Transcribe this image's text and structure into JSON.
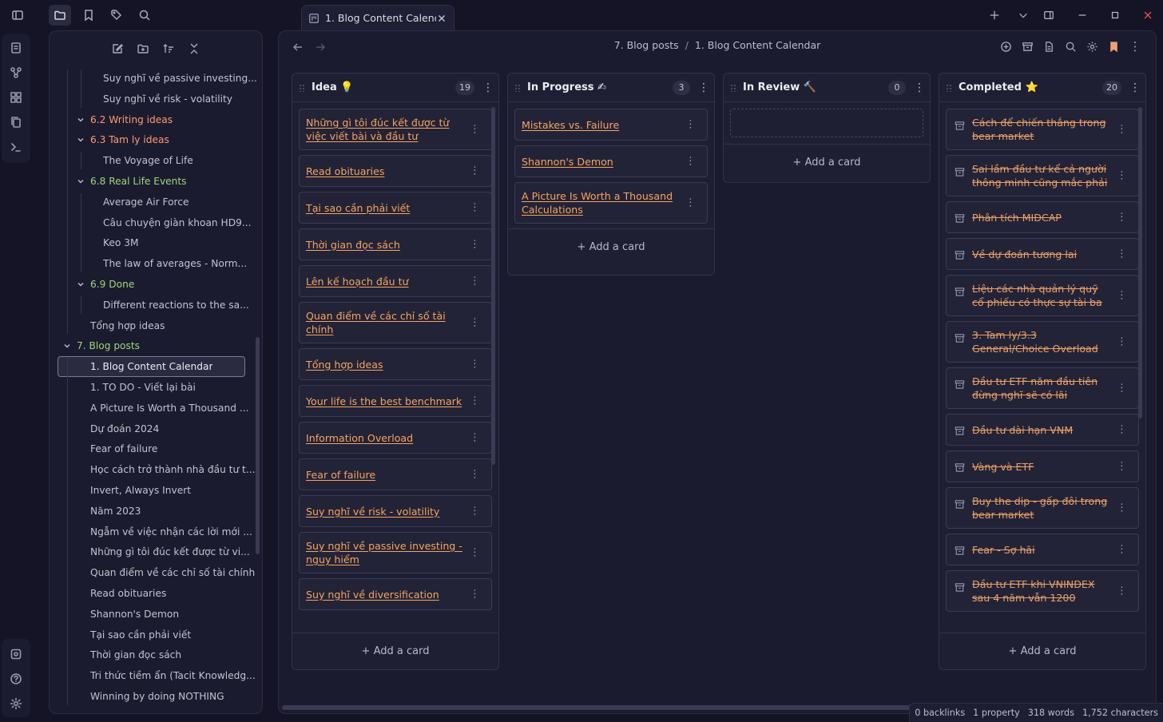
{
  "tab": {
    "title": "1. Blog Content Calend..."
  },
  "breadcrumb": {
    "parent": "7. Blog posts",
    "separator": "/",
    "current": "1. Blog Content Calendar"
  },
  "sidebar": {
    "items": [
      {
        "label": "Suy nghĩ về passive investing...",
        "kind": "file",
        "indent": 2
      },
      {
        "label": "Suy nghĩ về risk - volatility",
        "kind": "file",
        "indent": 2
      },
      {
        "label": "6.2 Writing ideas",
        "kind": "folder",
        "indent": 1
      },
      {
        "label": "6.3 Tam ly ideas",
        "kind": "folder",
        "indent": 1
      },
      {
        "label": "The Voyage of Life",
        "kind": "file",
        "indent": 2
      },
      {
        "label": "6.8 Real Life Events",
        "kind": "folder-green",
        "indent": 1
      },
      {
        "label": "Average Air Force",
        "kind": "file",
        "indent": 2
      },
      {
        "label": "Câu chuyện giàn khoan HD9...",
        "kind": "file",
        "indent": 2
      },
      {
        "label": "Keo 3M",
        "kind": "file",
        "indent": 2
      },
      {
        "label": "The law of averages - Norm...",
        "kind": "file",
        "indent": 2
      },
      {
        "label": "6.9 Done",
        "kind": "folder-green",
        "indent": 1
      },
      {
        "label": "Different reactions to the sa...",
        "kind": "file",
        "indent": 2
      },
      {
        "label": "Tổng hợp ideas",
        "kind": "file",
        "indent": 1
      },
      {
        "label": "7. Blog posts",
        "kind": "folder-green",
        "indent": 0
      },
      {
        "label": "1. Blog Content Calendar",
        "kind": "selected",
        "indent": 1
      },
      {
        "label": "1. TO DO - Viết lại bài",
        "kind": "file",
        "indent": 1
      },
      {
        "label": "A Picture Is Worth a Thousand ...",
        "kind": "file",
        "indent": 1
      },
      {
        "label": "Dự đoán 2024",
        "kind": "file",
        "indent": 1
      },
      {
        "label": "Fear of failure",
        "kind": "file",
        "indent": 1
      },
      {
        "label": "Học cách trở thành nhà đầu tư t...",
        "kind": "file",
        "indent": 1
      },
      {
        "label": "Invert, Always Invert",
        "kind": "file",
        "indent": 1
      },
      {
        "label": "Năm 2023",
        "kind": "file",
        "indent": 1
      },
      {
        "label": "Ngẫm về việc nhận các lời mới ...",
        "kind": "file",
        "indent": 1
      },
      {
        "label": "Những gì tôi đúc kết được từ vi...",
        "kind": "file",
        "indent": 1
      },
      {
        "label": "Quan điểm về các chỉ số tài chính",
        "kind": "file",
        "indent": 1
      },
      {
        "label": "Read obituaries",
        "kind": "file",
        "indent": 1
      },
      {
        "label": "Shannon's Demon",
        "kind": "file",
        "indent": 1
      },
      {
        "label": "Tại sao cần phải viết",
        "kind": "file",
        "indent": 1
      },
      {
        "label": "Thời gian đọc sách",
        "kind": "file",
        "indent": 1
      },
      {
        "label": "Tri thức tiềm ẩn (Tacit Knowledg...",
        "kind": "file",
        "indent": 1
      },
      {
        "label": "Winning by doing NOTHING",
        "kind": "file",
        "indent": 1
      }
    ]
  },
  "board": {
    "add_card_label": "+ Add a card",
    "lanes": [
      {
        "title": "Idea 💡",
        "count": "19",
        "cards": [
          "Những gì tôi đúc kết được từ việc viết bài và đầu tư",
          "Read obituaries",
          "Tại sao cần phải viết",
          "Thời gian đọc sách",
          "Lên kế hoạch đầu tư",
          "Quan điểm về các chỉ số tài chính",
          "Tổng hợp ideas",
          "Your life is the best benchmark",
          "Information Overload",
          "Fear of failure",
          "Suy nghĩ về risk - volatility",
          "Suy nghĩ về passive investing - nguy hiểm",
          "Suy nghĩ về diversification"
        ]
      },
      {
        "title": "In Progress ✍",
        "count": "3",
        "cards": [
          "Mistakes vs. Failure",
          "Shannon's Demon",
          "A Picture Is Worth a Thousand Calculations"
        ]
      },
      {
        "title": "In Review 🔨",
        "count": "0",
        "cards": []
      },
      {
        "title": "Completed ⭐",
        "count": "20",
        "cards": [
          "Cách để chiến thắng trong bear market",
          "Sai lầm đầu tư kể cả người thông minh cũng mắc phải",
          "Phân tích MIDCAP",
          "Về dự đoán tương lai",
          "Liệu các nhà quản lý quỹ cổ phiếu có thực sự tài ba",
          "3. Tam ly/3.3 General/Choice Overload",
          "Đầu tư ETF năm đầu tiên đừng nghĩ sẽ có lãi",
          "Đầu tư dài hạn VNM",
          "Vàng và ETF",
          "Buy the dip - gấp đôi trong bear market",
          "Fear - Sợ hãi",
          "Đầu tư ETF khi VNINDEX sau 4 năm vẫn 1200"
        ]
      }
    ]
  },
  "status": {
    "backlinks": "0 backlinks",
    "properties": "1 property",
    "words": "318 words",
    "characters": "1,752 characters"
  },
  "colors": {
    "accent": "#f4a45e",
    "folder": "#ff9a70",
    "folder_green": "#9ed57a"
  }
}
